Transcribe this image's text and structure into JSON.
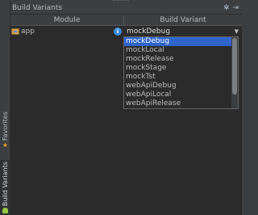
{
  "panel": {
    "title": "Build Variants"
  },
  "table": {
    "headers": {
      "module": "Module",
      "build_variant": "Build Variant"
    },
    "rows": [
      {
        "module": "app",
        "build_variant": "mockDebug"
      }
    ]
  },
  "dropdown": {
    "selected": "mockDebug",
    "options": [
      "mockDebug",
      "mockLocal",
      "mockRelease",
      "mockStage",
      "mockTst",
      "webApiDebug",
      "webApiLocal",
      "webApiRelease"
    ]
  },
  "side_tabs": {
    "favorites": "Favorites",
    "build_variants": "Build Variants"
  },
  "icons": {
    "module": "folder-icon",
    "info": "info-icon",
    "settings": "gear-icon",
    "hide": "hide-panel-icon",
    "favorites": "star-icon",
    "build_variants": "android-icon"
  },
  "colors": {
    "selection": "#2f65ca",
    "info": "#3d8edb",
    "star": "#e0a42c",
    "android": "#9bc847"
  }
}
